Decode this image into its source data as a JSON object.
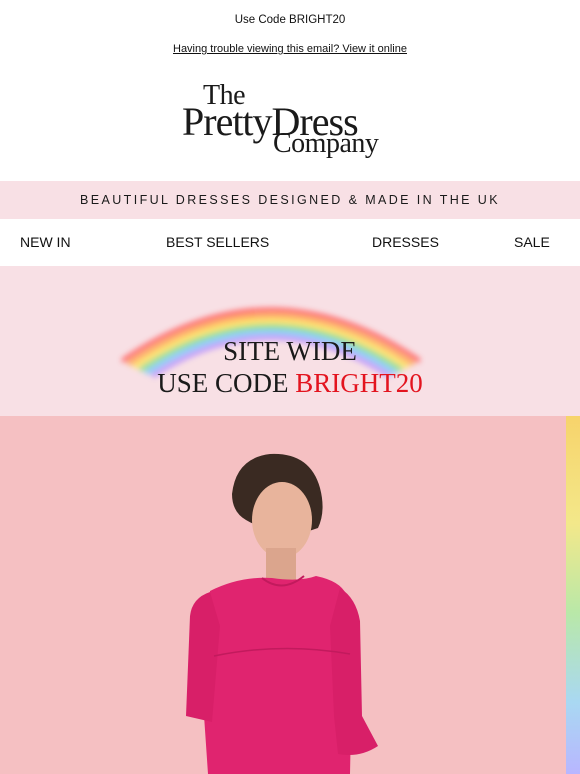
{
  "preheader": {
    "text": "Use Code BRIGHT20"
  },
  "view_online": {
    "text": "Having trouble viewing this email? View it online"
  },
  "logo": {
    "line1": "The",
    "line2": "PrettyDress",
    "line3": "Company"
  },
  "tagline": "BEAUTIFUL DRESSES DESIGNED & MADE IN THE UK",
  "nav": {
    "items": [
      {
        "label": "NEW IN"
      },
      {
        "label": "BEST SELLERS"
      },
      {
        "label": "DRESSES"
      },
      {
        "label": "SALE"
      }
    ]
  },
  "promo": {
    "line1": "SITE WIDE",
    "line2_prefix": "USE CODE ",
    "code": "BRIGHT20",
    "code_color": "#e3141f"
  },
  "hero": {
    "background": "#f5c0c2",
    "dress_color": "#e0246f",
    "icon": "model-in-pink-dress-illustration"
  },
  "colors": {
    "banner_pink": "#f8e0e5",
    "text": "#111111"
  }
}
